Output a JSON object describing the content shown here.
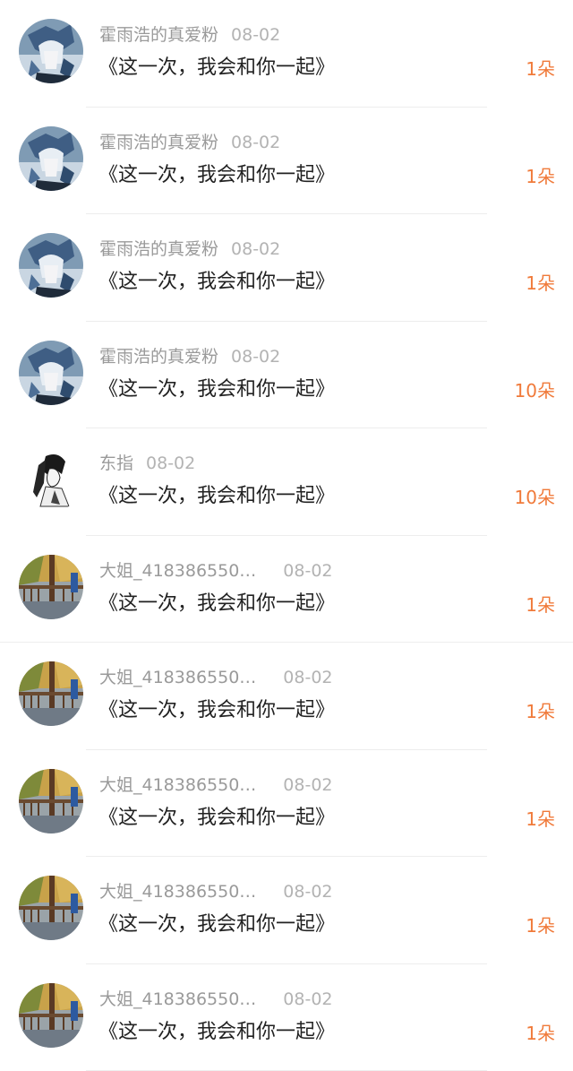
{
  "rows": [
    {
      "user": "霍雨浩的真爱粉",
      "date": "08-02",
      "title": "《这一次，我会和你一起》",
      "count": "1朵",
      "avatar": "anime-blue"
    },
    {
      "user": "霍雨浩的真爱粉",
      "date": "08-02",
      "title": "《这一次，我会和你一起》",
      "count": "1朵",
      "avatar": "anime-blue"
    },
    {
      "user": "霍雨浩的真爱粉",
      "date": "08-02",
      "title": "《这一次，我会和你一起》",
      "count": "1朵",
      "avatar": "anime-blue"
    },
    {
      "user": "霍雨浩的真爱粉",
      "date": "08-02",
      "title": "《这一次，我会和你一起》",
      "count": "10朵",
      "avatar": "anime-blue"
    },
    {
      "user": "东指",
      "date": "08-02",
      "title": "《这一次，我会和你一起》",
      "count": "10朵",
      "avatar": "ink-sketch"
    },
    {
      "user": "大姐_418386550…",
      "date": "08-02",
      "title": "《这一次，我会和你一起》",
      "count": "1朵",
      "avatar": "autumn-scene"
    },
    {
      "user": "大姐_418386550…",
      "date": "08-02",
      "title": "《这一次，我会和你一起》",
      "count": "1朵",
      "avatar": "autumn-scene"
    },
    {
      "user": "大姐_418386550…",
      "date": "08-02",
      "title": "《这一次，我会和你一起》",
      "count": "1朵",
      "avatar": "autumn-scene"
    },
    {
      "user": "大姐_418386550…",
      "date": "08-02",
      "title": "《这一次，我会和你一起》",
      "count": "1朵",
      "avatar": "autumn-scene"
    },
    {
      "user": "大姐_418386550…",
      "date": "08-02",
      "title": "《这一次，我会和你一起》",
      "count": "1朵",
      "avatar": "autumn-scene"
    }
  ],
  "colors": {
    "count": "#f07a3a",
    "username": "#9a9a9a",
    "title": "#222222"
  }
}
